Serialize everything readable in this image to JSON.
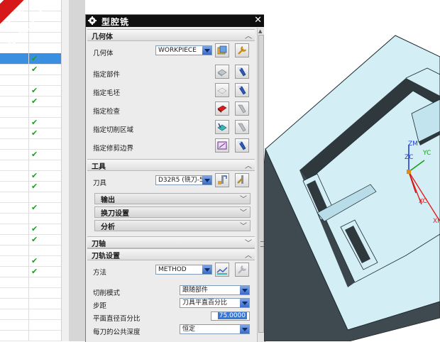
{
  "watermark": {
    "line1": "9SUG",
    "line2": "学UG就上UG网"
  },
  "navigator": {
    "selected_row": 5,
    "rows": [
      {
        "checked": false
      },
      {
        "checked": false
      },
      {
        "checked": false
      },
      {
        "checked": false
      },
      {
        "checked": false
      },
      {
        "checked": true
      },
      {
        "checked": true
      },
      {
        "checked": false
      },
      {
        "checked": true
      },
      {
        "checked": true
      },
      {
        "checked": false
      },
      {
        "checked": true
      },
      {
        "checked": true
      },
      {
        "checked": false
      },
      {
        "checked": true
      },
      {
        "checked": false
      },
      {
        "checked": true
      },
      {
        "checked": true
      },
      {
        "checked": false
      },
      {
        "checked": true
      },
      {
        "checked": false
      },
      {
        "checked": true
      },
      {
        "checked": true
      },
      {
        "checked": false
      },
      {
        "checked": true
      },
      {
        "checked": true
      },
      {
        "checked": false
      },
      {
        "checked": false
      },
      {
        "checked": false
      },
      {
        "checked": false
      },
      {
        "checked": false
      },
      {
        "checked": false
      }
    ]
  },
  "dialog": {
    "title": "型腔铣",
    "geometry": {
      "header": "几何体",
      "geometry_label": "几何体",
      "geometry_value": "WORKPIECE",
      "specify_part": "指定部件",
      "specify_blank": "指定毛坯",
      "specify_check": "指定检查",
      "specify_cut_area": "指定切削区域",
      "specify_trim_boundary": "指定修剪边界"
    },
    "tool": {
      "header": "工具",
      "tool_label": "刀具",
      "tool_value": "D32R5 (铣刀-5",
      "output": "输出",
      "tool_change": "换刀设置",
      "analysis": "分析"
    },
    "axis": {
      "header": "刀轴"
    },
    "path": {
      "header": "刀轨设置",
      "method_label": "方法",
      "method_value": "METHOD",
      "cut_pattern_label": "切削模式",
      "cut_pattern_value": "跟随部件",
      "stepover_label": "步距",
      "stepover_value": "刀具平直百分比",
      "diameter_pct_label": "平面直径百分比",
      "diameter_pct_value": "75.0000",
      "depth_label": "每刀的公共深度",
      "depth_value": "恒定"
    }
  },
  "csys": {
    "zm": "ZM",
    "zc": "ZC",
    "yc": "YC",
    "xc": "XC",
    "xm": "XM"
  },
  "colors": {
    "titlebar": "#0f0f0f",
    "selection": "#3a8fe0",
    "check": "#1e9e22",
    "part_face": "#d4eef5",
    "watermark": "#d61818"
  }
}
